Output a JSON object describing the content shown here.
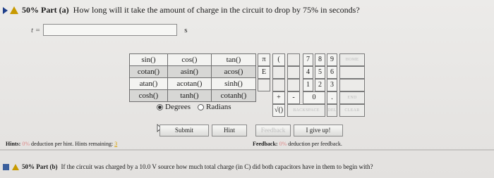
{
  "part_a": {
    "label": "50% Part (a)",
    "question": "How long will it take the amount of charge in the circuit to drop by 75% in seconds?",
    "variable": "t =",
    "input_value": "",
    "unit": "s"
  },
  "functions": {
    "rows": [
      [
        "sin()",
        "cos()",
        "tan()"
      ],
      [
        "cotan()",
        "asin()",
        "acos()"
      ],
      [
        "atan()",
        "acotan()",
        "sinh()"
      ],
      [
        "cosh()",
        "tanh()",
        "cotanh()"
      ]
    ],
    "degrees_label": "Degrees",
    "radians_label": "Radians",
    "selected_mode": "Degrees"
  },
  "keypad": {
    "pi": "π",
    "open_paren": "(",
    "e": "E",
    "plus": "+",
    "minus": "-",
    "sqrt": "√()",
    "digits": [
      "7",
      "8",
      "9",
      "4",
      "5",
      "6",
      "1",
      "2",
      "3",
      "0",
      "."
    ],
    "home": "HOME",
    "end": "END",
    "backspace": "BACKSPACE",
    "del": "DEL",
    "clear": "CLEAR"
  },
  "buttons": {
    "submit": "Submit",
    "hint": "Hint",
    "feedback": "Feedback",
    "give_up": "I give up!"
  },
  "hints": {
    "label": "Hints:",
    "pct": "0%",
    "text": "deduction per hint. Hints remaining:",
    "remaining": "3"
  },
  "feedback_info": {
    "label": "Feedback:",
    "pct": "0%",
    "text": "deduction per feedback."
  },
  "part_b": {
    "label": "50% Part (b)",
    "question": "If the circuit was charged by a 10.0 V source how much total charge (in C) did both capacitors have in them to begin with?"
  },
  "colors": {
    "accent_blue": "#1f3f8a",
    "warning": "#c89a00"
  }
}
